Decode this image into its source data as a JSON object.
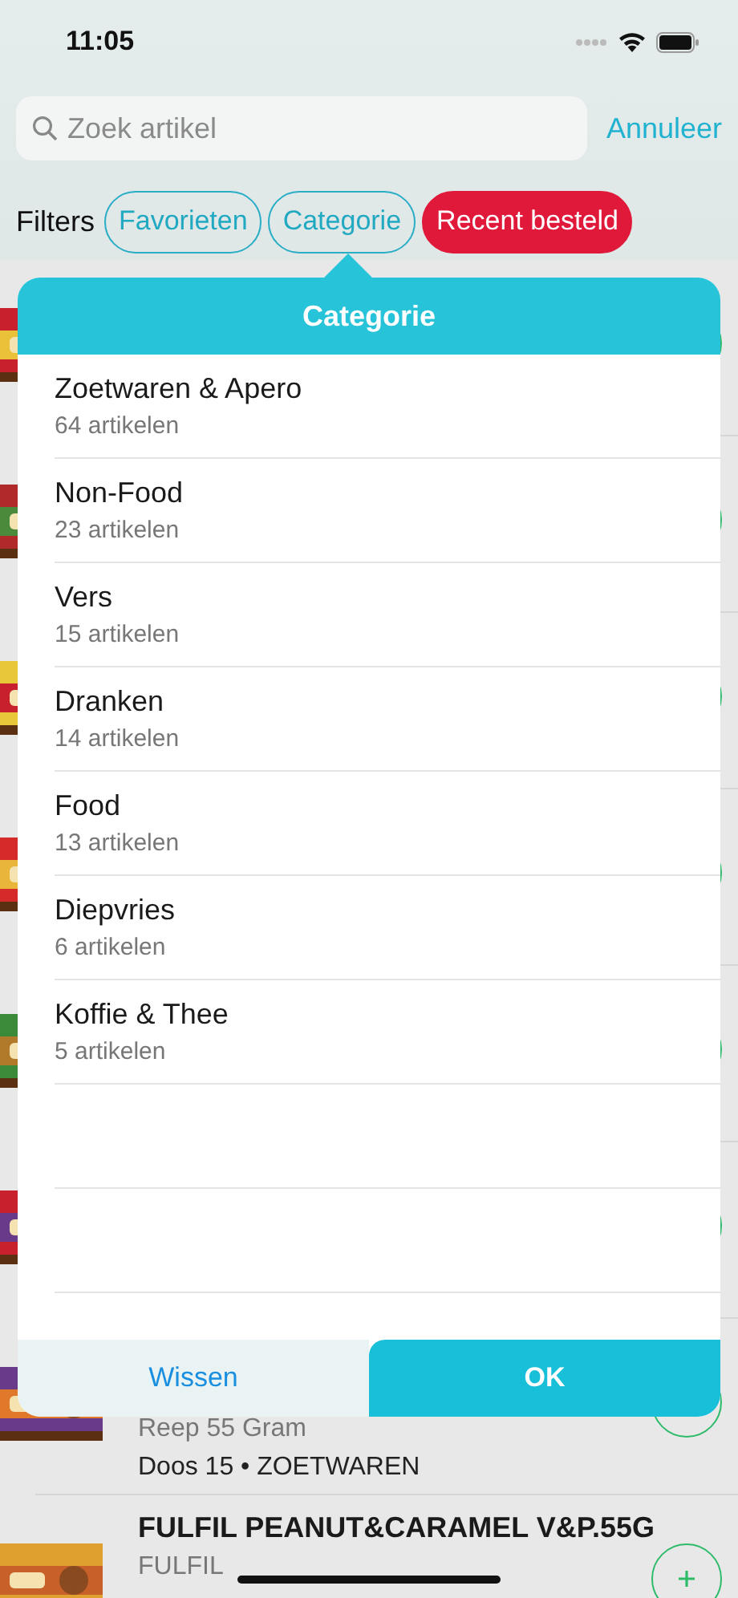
{
  "status_bar": {
    "time": "11:05"
  },
  "search": {
    "placeholder": "Zoek artikel",
    "cancel": "Annuleer"
  },
  "filters": {
    "label": "Filters",
    "chips": [
      {
        "label": "Favorieten",
        "selected": false
      },
      {
        "label": "Categorie",
        "selected": false
      },
      {
        "label": "Recent besteld",
        "selected": true
      }
    ]
  },
  "products": [
    {
      "kind": "covered"
    },
    {
      "kind": "covered"
    },
    {
      "kind": "covered"
    },
    {
      "kind": "covered"
    },
    {
      "kind": "covered"
    },
    {
      "kind": "covered"
    },
    {
      "kind": "partial",
      "unit": "Reep 55 Gram",
      "package": "Doos 15 • ZOETWAREN"
    },
    {
      "kind": "product",
      "name": "FULFIL PEANUT&CARAMEL V&P.55G",
      "brand": "FULFIL"
    }
  ],
  "popover": {
    "title": "Categorie",
    "categories": [
      {
        "name": "Zoetwaren & Apero",
        "count": "64 artikelen"
      },
      {
        "name": "Non-Food",
        "count": "23 artikelen"
      },
      {
        "name": "Vers",
        "count": "15 artikelen"
      },
      {
        "name": "Dranken",
        "count": "14 artikelen"
      },
      {
        "name": "Food",
        "count": "13 artikelen"
      },
      {
        "name": "Diepvries",
        "count": "6 artikelen"
      },
      {
        "name": "Koffie & Thee",
        "count": "5 artikelen"
      }
    ],
    "clear_button": "Wissen",
    "ok_button": "OK"
  }
}
